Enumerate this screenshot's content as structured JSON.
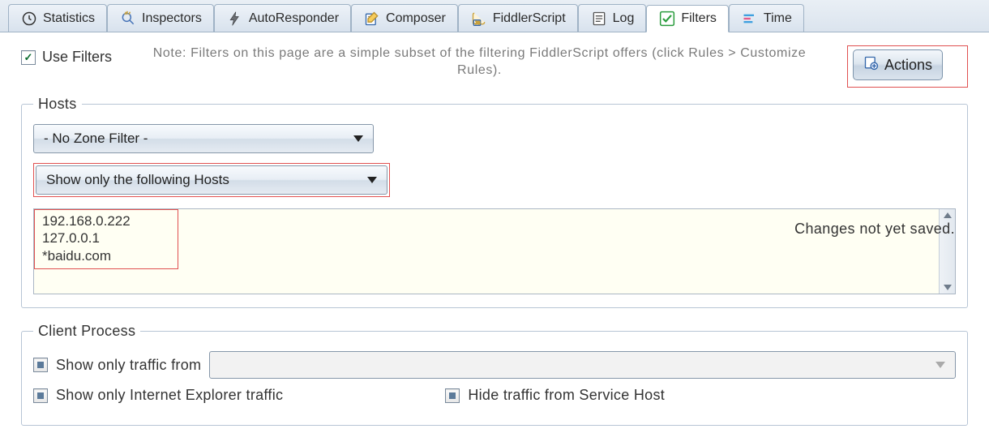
{
  "tabs": [
    {
      "id": "statistics",
      "label": "Statistics",
      "icon": "clock-icon",
      "active": false
    },
    {
      "id": "inspectors",
      "label": "Inspectors",
      "icon": "magnifier-icon",
      "active": false
    },
    {
      "id": "autoresponder",
      "label": "AutoResponder",
      "icon": "lightning-icon",
      "active": false
    },
    {
      "id": "composer",
      "label": "Composer",
      "icon": "compose-icon",
      "active": false
    },
    {
      "id": "fiddlerscript",
      "label": "FiddlerScript",
      "icon": "script-icon",
      "active": false
    },
    {
      "id": "log",
      "label": "Log",
      "icon": "document-icon",
      "active": false
    },
    {
      "id": "filters",
      "label": "Filters",
      "icon": "check-icon",
      "active": true
    },
    {
      "id": "timeline",
      "label": "Time",
      "icon": "timeline-icon",
      "active": false
    }
  ],
  "use_filters": {
    "label": "Use Filters",
    "checked": true
  },
  "note_text": "Note: Filters on this page are a simple subset of the filtering FiddlerScript offers (click Rules > Customize Rules).",
  "actions_button": {
    "label": "Actions"
  },
  "hosts": {
    "legend": "Hosts",
    "zone_filter": {
      "selected": "- No Zone Filter -"
    },
    "host_filter": {
      "selected": "Show only the following Hosts"
    },
    "changes_note": "Changes not yet saved.",
    "hosts_text": "192.168.0.222\n127.0.0.1\n*baidu.com"
  },
  "client_process": {
    "legend": "Client Process",
    "show_only_from": {
      "label": "Show only traffic from",
      "checked": false,
      "selected": ""
    },
    "show_only_ie": {
      "label": "Show only Internet Explorer traffic",
      "checked": false
    },
    "hide_service": {
      "label": "Hide traffic from Service Host",
      "checked": false
    }
  }
}
